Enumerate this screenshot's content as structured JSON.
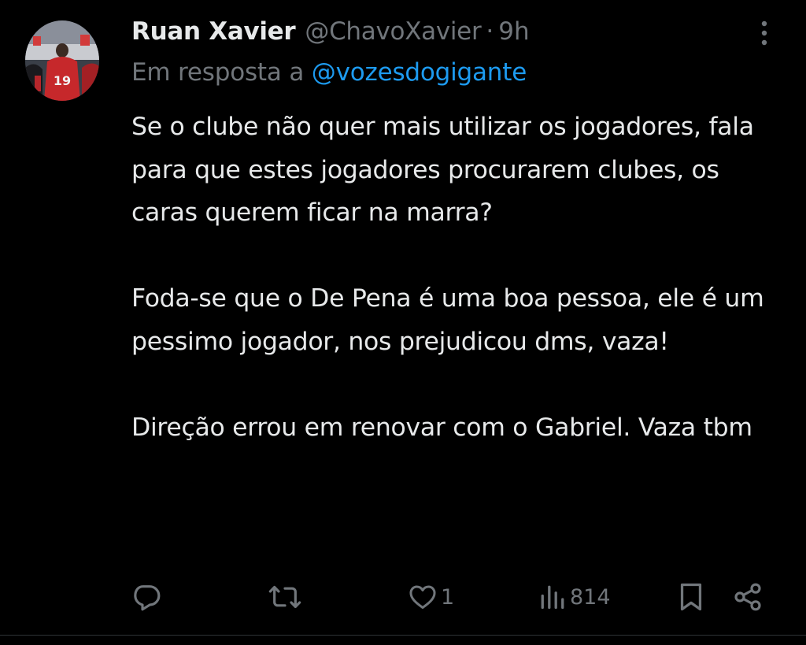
{
  "tweet": {
    "author": {
      "display_name": "Ruan Xavier",
      "handle": "@ChavoXavier",
      "separator": "·",
      "time": "9h"
    },
    "reply": {
      "prefix": "Em resposta a",
      "mention": "@vozesdogigante"
    },
    "paragraphs": [
      "Se o clube não quer mais utilizar os jogadores, fala para que estes jogadores procurarem clubes, os caras querem ficar na marra?",
      "Foda-se que o De Pena é uma boa pessoa, ele é um pessimo jogador, nos prejudicou dms, vaza!",
      "Direção errou em renovar com o Gabriel. Vaza tbm"
    ],
    "actions": {
      "reply_count": "",
      "retweet_count": "",
      "like_count": "1",
      "views_count": "814"
    }
  },
  "icons": {
    "more": "more-vertical-icon",
    "reply": "reply-icon",
    "retweet": "retweet-icon",
    "like": "heart-icon",
    "views": "views-icon",
    "bookmark": "bookmark-icon",
    "share": "share-icon"
  },
  "colors": {
    "background": "#000000",
    "text": "#e7e9ea",
    "muted": "#71767b",
    "accent": "#1d9bf0",
    "divider": "#2f3336"
  }
}
